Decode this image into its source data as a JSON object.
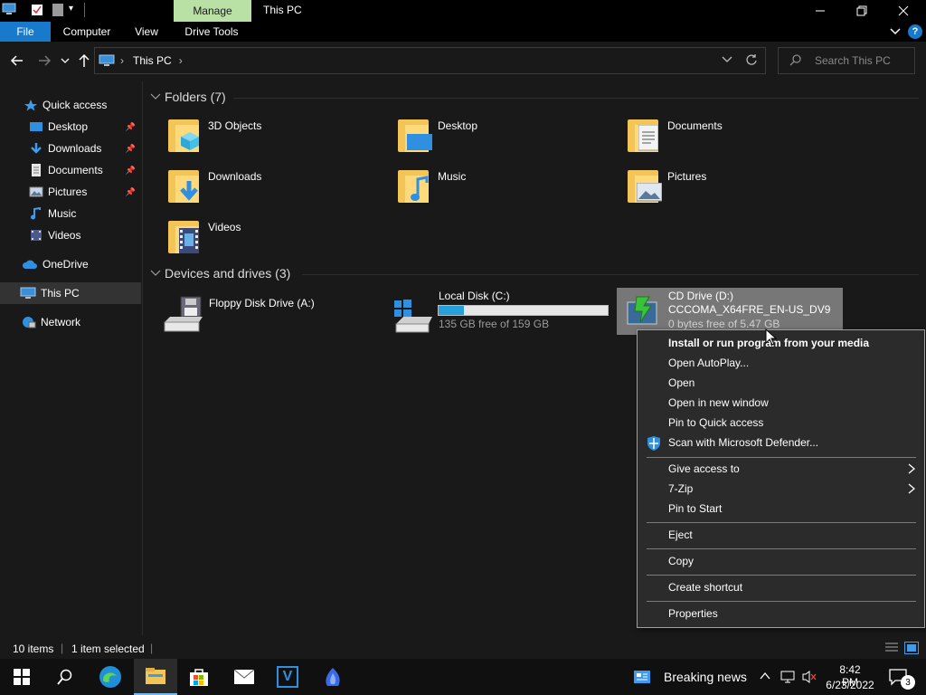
{
  "window": {
    "manage_tab": "Manage",
    "title": "This PC"
  },
  "ribbon": {
    "tabs": [
      "File",
      "Computer",
      "View",
      "Drive Tools"
    ]
  },
  "address": {
    "path": "This PC",
    "search_placeholder": "Search This PC"
  },
  "nav": {
    "items": [
      {
        "label": "Quick access",
        "icon": "star-icon"
      },
      {
        "label": "Desktop",
        "icon": "desktop-icon",
        "pinned": true
      },
      {
        "label": "Downloads",
        "icon": "download-icon",
        "pinned": true
      },
      {
        "label": "Documents",
        "icon": "documents-icon",
        "pinned": true
      },
      {
        "label": "Pictures",
        "icon": "pictures-icon",
        "pinned": true
      },
      {
        "label": "Music",
        "icon": "music-icon"
      },
      {
        "label": "Videos",
        "icon": "videos-icon"
      },
      {
        "label": "OneDrive",
        "icon": "cloud-icon"
      },
      {
        "label": "This PC",
        "icon": "computer-icon",
        "selected": true
      },
      {
        "label": "Network",
        "icon": "network-icon"
      }
    ]
  },
  "folders": {
    "header": "Folders (7)",
    "items": [
      "3D Objects",
      "Desktop",
      "Documents",
      "Downloads",
      "Music",
      "Pictures",
      "Videos"
    ]
  },
  "drives": {
    "header": "Devices and drives (3)",
    "floppy": {
      "name": "Floppy Disk Drive (A:)"
    },
    "c": {
      "name": "Local Disk (C:)",
      "free": "135 GB free of 159 GB",
      "used_fraction": 0.15
    },
    "d": {
      "name": "CD Drive (D:)",
      "label": "CCCOMA_X64FRE_EN-US_DV9",
      "free": "0 bytes free of 5.47 GB"
    }
  },
  "context_menu": {
    "items": {
      "install": "Install or run program from your media",
      "autoplay": "Open AutoPlay...",
      "open": "Open",
      "open_new": "Open in new window",
      "pin_quick": "Pin to Quick access",
      "scan": "Scan with Microsoft Defender...",
      "give_access": "Give access to",
      "zip": "7-Zip",
      "pin_start": "Pin to Start",
      "eject": "Eject",
      "copy": "Copy",
      "shortcut": "Create shortcut",
      "properties": "Properties"
    }
  },
  "status": {
    "items_count": "10 items",
    "selected": "1 item selected"
  },
  "taskbar": {
    "news": "Breaking news",
    "time": "8:42 PM",
    "date": "6/23/2022",
    "notif_count": "3"
  },
  "colors": {
    "accent": "#1979ca",
    "manage_tab": "#b9e0a5",
    "drive_bar": "#26a0da",
    "folder": "#f3c456"
  }
}
